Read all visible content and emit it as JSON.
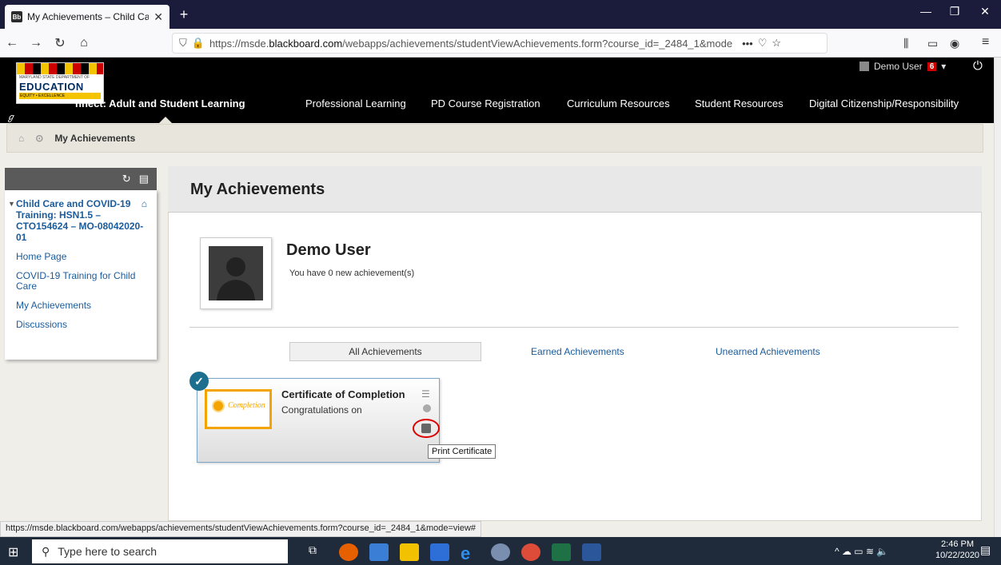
{
  "browser": {
    "tab_title": "My Achievements – Child Care",
    "tab_icon": "Bb",
    "url_prefix": "https://msde.",
    "url_host": "blackboard.com",
    "url_rest": "/webapps/achievements/studentViewAchievements.form?course_id=_2484_1&mode",
    "url_more": "•••"
  },
  "site": {
    "logo_subtitle": "MARYLAND STATE DEPARTMENT OF",
    "logo_main": "EDUCATION",
    "logo_tagline": "EQUITY • EXCELLENCE",
    "nav": [
      "nnect: Adult and Student Learning",
      "Professional Learning",
      "PD Course Registration",
      "Curriculum Resources",
      "Student Resources",
      "Digital Citizenship/Responsibility"
    ],
    "user_name": "Demo User",
    "badge_count": "6"
  },
  "breadcrumb": {
    "current": "My Achievements"
  },
  "course_menu": {
    "course_title": "Child Care and COVID-19 Training: HSN1.5 – CTO154624 – MO-08042020-01",
    "items": [
      "Home Page",
      "COVID-19 Training for Child Care",
      "My Achievements",
      "Discussions"
    ]
  },
  "main": {
    "title": "My Achievements",
    "user_name": "Demo User",
    "new_achievements": "You have 0 new achievement(s)",
    "filters": [
      "All Achievements",
      "Earned Achievements",
      "Unearned Achievements"
    ],
    "card": {
      "title": "Certificate of Completion",
      "description": "Congratulations on",
      "image_text": "Completion",
      "tooltip": "Print Certificate"
    }
  },
  "status_url": "https://msde.blackboard.com/webapps/achievements/studentViewAchievements.form?course_id=_2484_1&mode=view#",
  "taskbar": {
    "search_placeholder": "Type here to search",
    "time": "2:46 PM",
    "date": "10/22/2020"
  }
}
